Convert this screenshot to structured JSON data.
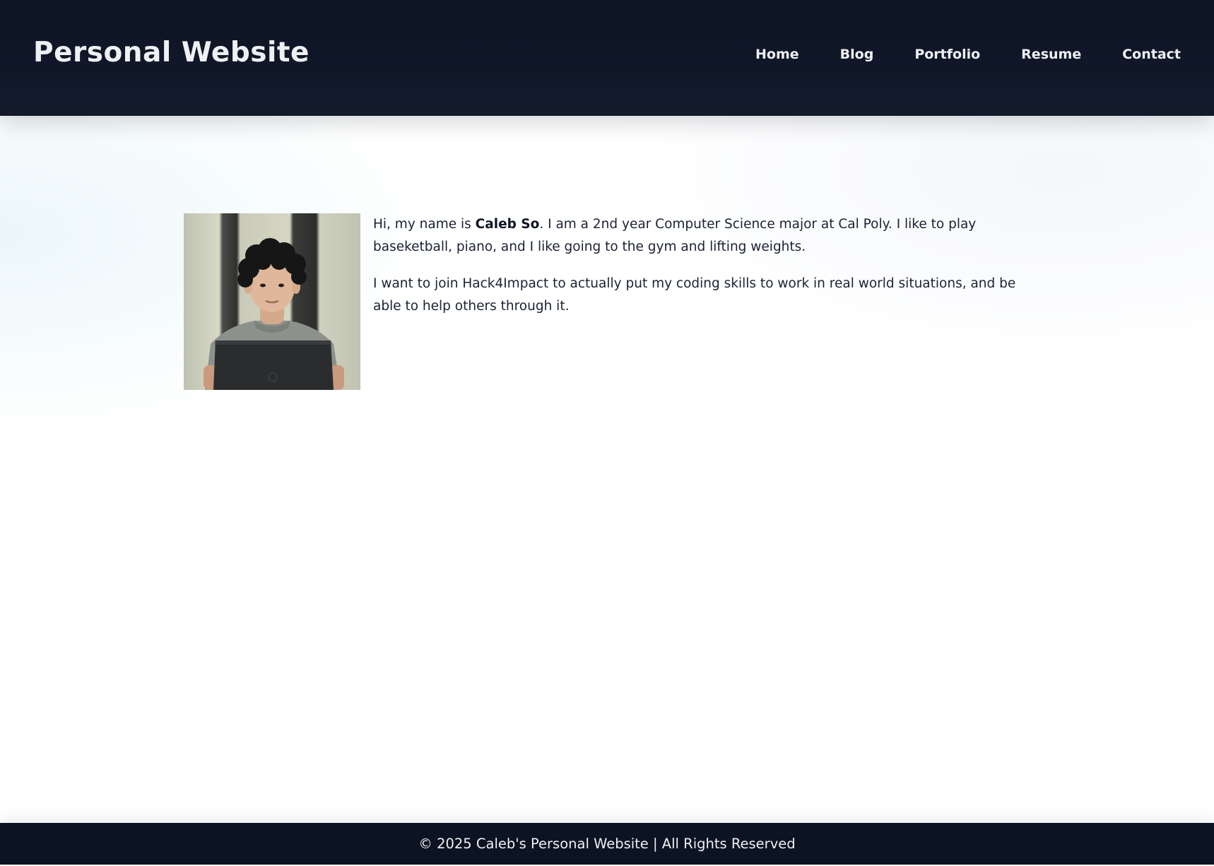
{
  "header": {
    "title": "Personal Website",
    "nav": [
      "Home",
      "Blog",
      "Portfolio",
      "Resume",
      "Contact"
    ]
  },
  "about": {
    "photo_icon": "profile-photo",
    "intro_prefix": "Hi, my name is ",
    "name": "Caleb So",
    "intro_suffix": ". I am a 2nd year Computer Science major at Cal Poly. I like to play baseketball, piano, and I like going to the gym and lifting weights.",
    "motivation": "I want to join Hack4Impact to actually put my coding skills to work in real world situations, and be able to help others through it."
  },
  "footer": {
    "text": "© 2025 Caleb's Personal Website | All Rights Reserved"
  },
  "colors": {
    "header_bg": "#0d1424",
    "header_text": "#eef0f4",
    "body_text": "#1b2232",
    "footer_bg": "#0c1322"
  }
}
